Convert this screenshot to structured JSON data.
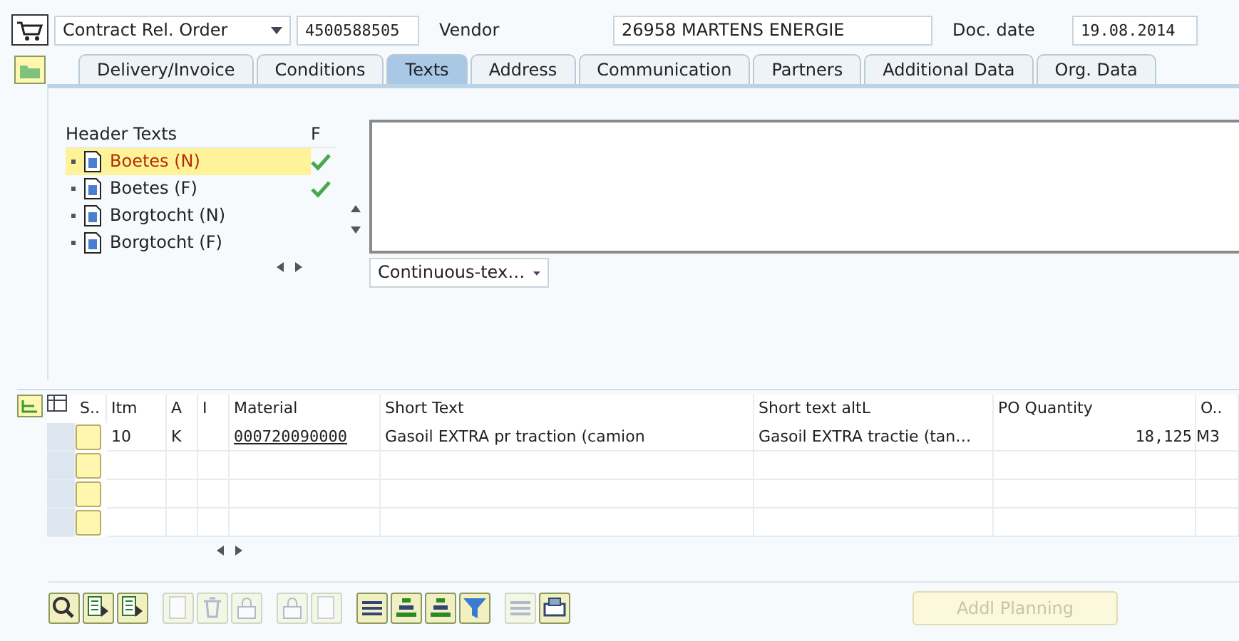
{
  "header": {
    "doc_type": "Contract Rel. Order",
    "doc_number": "4500588505",
    "vendor_label": "Vendor",
    "vendor": "26958 MARTENS ENERGIE",
    "date_label": "Doc. date",
    "date": "19.08.2014"
  },
  "tabs": [
    {
      "label": "Delivery/Invoice",
      "selected": false
    },
    {
      "label": "Conditions",
      "selected": false
    },
    {
      "label": "Texts",
      "selected": true
    },
    {
      "label": "Address",
      "selected": false
    },
    {
      "label": "Communication",
      "selected": false
    },
    {
      "label": "Partners",
      "selected": false
    },
    {
      "label": "Additional Data",
      "selected": false
    },
    {
      "label": "Org. Data",
      "selected": false
    }
  ],
  "header_texts": {
    "title": "Header Texts",
    "column_2": "F",
    "items": [
      {
        "label": "Boetes (N)",
        "selected": true,
        "checked": true
      },
      {
        "label": "Boetes (F)",
        "selected": false,
        "checked": true
      },
      {
        "label": "Borgtocht (N)",
        "selected": false,
        "checked": false
      },
      {
        "label": "Borgtocht (F)",
        "selected": false,
        "checked": false
      }
    ]
  },
  "text_format": "Continuous-tex…",
  "items_table": {
    "columns": [
      "S..",
      "Itm",
      "A",
      "I",
      "Material",
      "Short Text",
      "Short text altL",
      "PO Quantity",
      "O.."
    ],
    "rows": [
      {
        "item": "10",
        "account_assignment": "K",
        "material": "000720090000",
        "short_text": "Gasoil EXTRA pr traction (camion",
        "short_text_alt": "Gasoil EXTRA tractie (tan…",
        "po_quantity": "18,125",
        "unit": "M3"
      }
    ]
  },
  "toolbar": {
    "buttons": [
      {
        "kind": "zoom",
        "disabled": false
      },
      {
        "kind": "detail",
        "disabled": false
      },
      {
        "kind": "detail",
        "disabled": false
      },
      {
        "kind": "blank",
        "disabled": true
      },
      {
        "kind": "trash",
        "disabled": true
      },
      {
        "kind": "lock",
        "disabled": true
      },
      {
        "kind": "lock",
        "disabled": true
      },
      {
        "kind": "blank",
        "disabled": true
      },
      {
        "kind": "lines",
        "disabled": false
      },
      {
        "kind": "sort",
        "disabled": false
      },
      {
        "kind": "sort",
        "disabled": false
      },
      {
        "kind": "filter",
        "disabled": false
      },
      {
        "kind": "lines",
        "disabled": true
      },
      {
        "kind": "print",
        "disabled": false
      }
    ],
    "addl_planning": {
      "label": "Addl Planning",
      "disabled": true
    }
  }
}
